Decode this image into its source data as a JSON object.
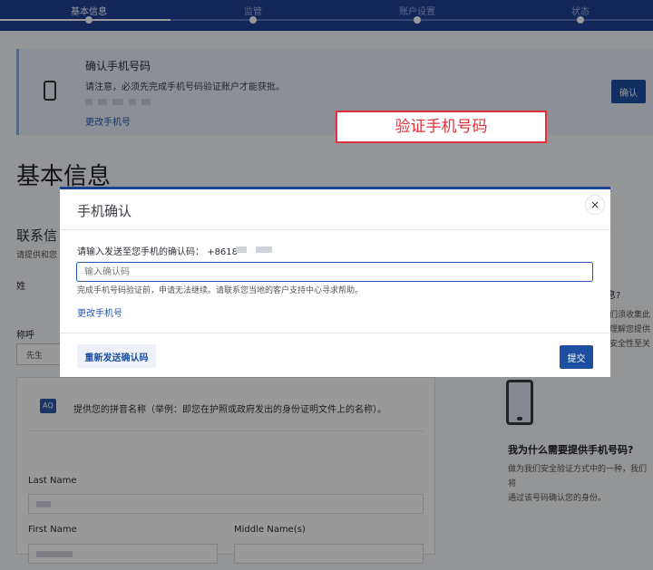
{
  "stepper": {
    "steps": [
      "基本信息",
      "监管",
      "账户设置",
      "状态"
    ]
  },
  "banner": {
    "title": "确认手机号码",
    "text": "请注意，必须先完成手机号码验证账户才能获批。",
    "link": "更改手机号",
    "button": "确认"
  },
  "annotation": "验证手机号码",
  "page": {
    "heading": "基本信息",
    "contact_heading": "联系信",
    "contact_sub": "请提供和您",
    "last_name_label": "姓",
    "title_label": "称呼",
    "title_value": "先生"
  },
  "card": {
    "icon_text": "AQ",
    "note": "提供您的拼音名称（举例：即您在护照或政府发出的身份证明文件上的名称）。",
    "last_name_label": "Last Name",
    "first_name_label": "First Name",
    "middle_name_label": "Middle Name(s)"
  },
  "sidebar": {
    "partial_heading": "息?",
    "partial_lines": [
      "们须收集此",
      "理解您提供",
      "安全性至关"
    ],
    "why_heading": "我为什么需要提供手机号码?",
    "why_lines": [
      "做为我们安全验证方式中的一种，我们将",
      "通过该号码确认您的身份。"
    ]
  },
  "modal": {
    "title": "手机确认",
    "close": "×",
    "prompt": "请输入发送至您手机的确认码：",
    "prompt_number": "+8618",
    "input_placeholder": "输入确认码",
    "help": "完成手机号码验证前，申请无法继续。请联系您当地的客户支持中心寻求帮助。",
    "change_link": "更改手机号",
    "resend": "重新发送确认码",
    "submit": "提交"
  }
}
